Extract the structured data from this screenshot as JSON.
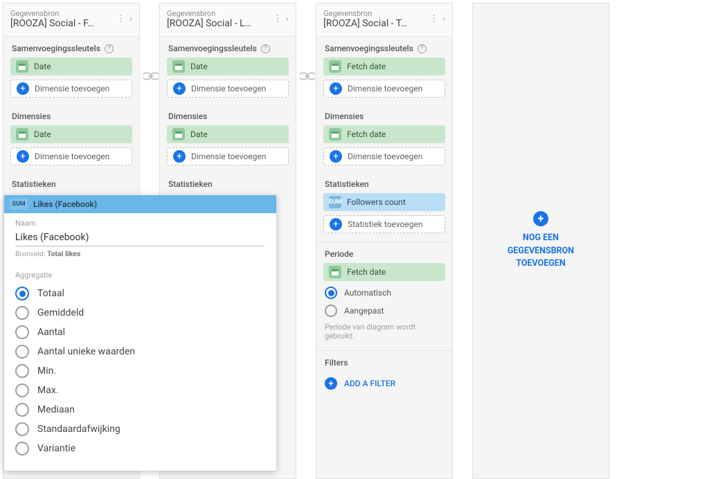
{
  "labels": {
    "datasource": "Gegevensbron",
    "joinkeys": "Samenvoegingssleutels",
    "dimensions": "Dimensies",
    "metrics": "Statistieken",
    "period": "Periode",
    "filters": "Filters",
    "add_dimension": "Dimensie toevoegen",
    "add_metric": "Statistiek toevoegen",
    "add_filter": "ADD A FILTER",
    "period_auto": "Automatisch",
    "period_custom": "Aangepast",
    "period_note": "Periode van diagram wordt gebruikt.",
    "add_source": "NOG EEN GEGEVENSBRON TOEVOEGEN",
    "sum_badge": "SUM"
  },
  "columns": [
    {
      "name": "[ROOZA] Social - F…",
      "join_key": "Date",
      "dimension": "Date"
    },
    {
      "name": "[ROOZA] Social - L…",
      "join_key": "Date",
      "dimension": "Date"
    },
    {
      "name": "[ROOZA] Social - T…",
      "join_key": "Fetch date",
      "dimension": "Fetch date",
      "metric": "Followers count",
      "period_dim": "Fetch date"
    }
  ],
  "popup": {
    "header": "Likes (Facebook)",
    "name_label": "Naam",
    "name_value": "Likes (Facebook)",
    "source_label": "Bronveld:",
    "source_value": "Total likes",
    "agg_label": "Aggregatie",
    "agg_options": [
      "Totaal",
      "Gemiddeld",
      "Aantal",
      "Aantal unieke waarden",
      "Min.",
      "Max.",
      "Mediaan",
      "Standaardafwijking",
      "Variantie"
    ],
    "agg_selected": 0
  }
}
